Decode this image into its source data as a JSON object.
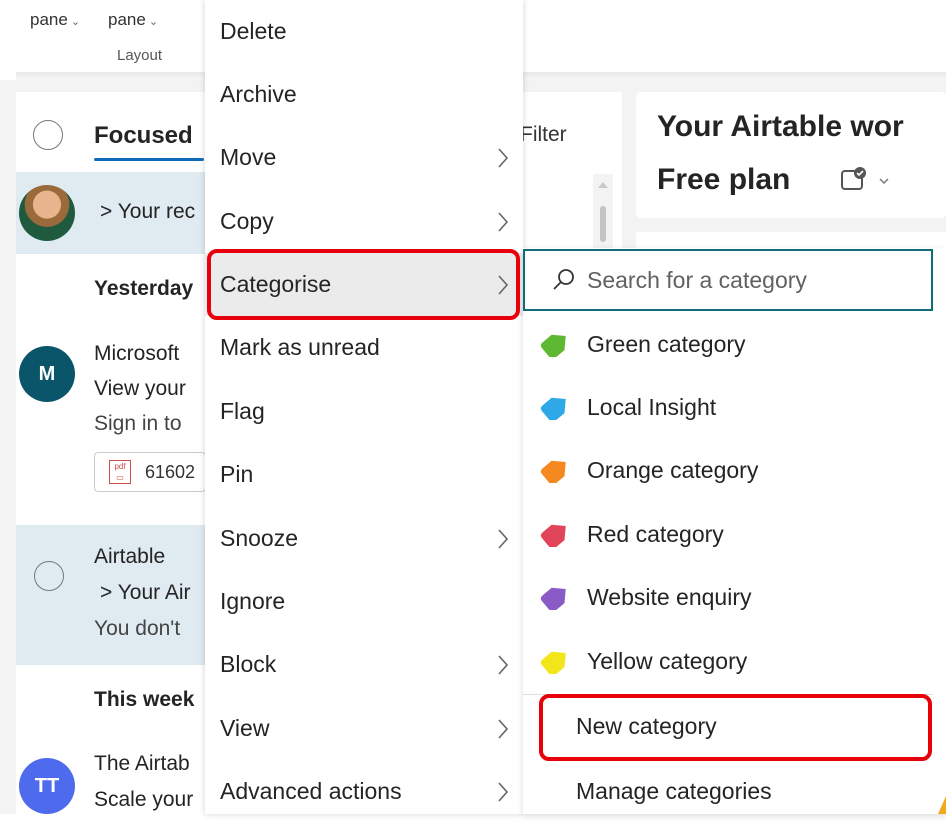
{
  "ribbon": {
    "item1": "pane",
    "item2": "pane",
    "group_label": "Layout"
  },
  "mail_list": {
    "tab_focused": "Focused",
    "filter_label": "Filter",
    "groups": {
      "yesterday": "Yesterday",
      "this_week": "This week"
    },
    "items": [
      {
        "sender": "",
        "line1": "> Your rec",
        "avatar": "photo"
      },
      {
        "sender": "Microsoft",
        "line1": "View your",
        "line2": "Sign in to",
        "attachment": "61602",
        "avatar_initial": "M",
        "avatar_color": "#0b556a"
      },
      {
        "sender": "Airtable",
        "line1": "> Your Air",
        "line2": "You don't",
        "avatar": "circle"
      },
      {
        "sender": "The Airtab",
        "line1": "Scale your",
        "avatar_initial": "TT",
        "avatar_color": "#4f6bed"
      }
    ]
  },
  "reading_pane": {
    "title": "Your Airtable wor",
    "subtitle": "Free plan"
  },
  "context_menu": {
    "items": [
      {
        "label": "Delete",
        "has_submenu": false
      },
      {
        "label": "Archive",
        "has_submenu": false
      },
      {
        "label": "Move",
        "has_submenu": true
      },
      {
        "label": "Copy",
        "has_submenu": true
      },
      {
        "label": "Categorise",
        "has_submenu": true,
        "active": true
      },
      {
        "label": "Mark as unread",
        "has_submenu": false
      },
      {
        "label": "Flag",
        "has_submenu": false
      },
      {
        "label": "Pin",
        "has_submenu": false
      },
      {
        "label": "Snooze",
        "has_submenu": true
      },
      {
        "label": "Ignore",
        "has_submenu": false
      },
      {
        "label": "Block",
        "has_submenu": true
      },
      {
        "label": "View",
        "has_submenu": true
      },
      {
        "label": "Advanced actions",
        "has_submenu": true
      }
    ]
  },
  "category_submenu": {
    "search_placeholder": "Search for a category",
    "categories": [
      {
        "label": "Green category",
        "color": "#5fb832"
      },
      {
        "label": "Local Insight",
        "color": "#2ea8e6"
      },
      {
        "label": "Orange category",
        "color": "#f5891f"
      },
      {
        "label": "Red category",
        "color": "#e0455a"
      },
      {
        "label": "Website enquiry",
        "color": "#8a5bc7"
      },
      {
        "label": "Yellow category",
        "color": "#f2e51a"
      }
    ],
    "new_category": "New category",
    "manage_categories": "Manage categories"
  },
  "accent": {
    "highlight_box": "#e8000b",
    "focus_underline": "#0f6cbd",
    "search_border": "#0f6c78"
  }
}
